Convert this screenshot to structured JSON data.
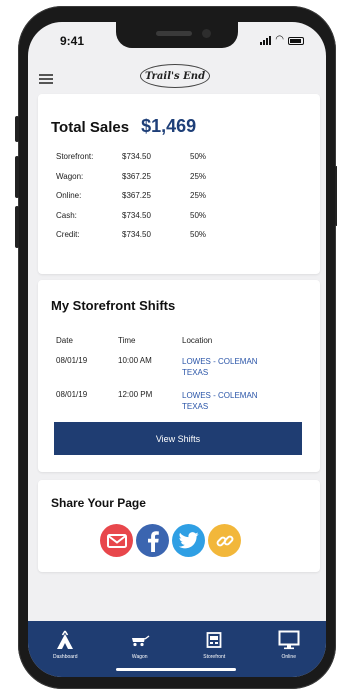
{
  "status": {
    "time": "9:41"
  },
  "header": {
    "logo_text": "Trail's End"
  },
  "sales": {
    "title": "Total Sales",
    "total": "$1,469",
    "rows": [
      {
        "label": "Storefront:",
        "amount": "$734.50",
        "percent": "50%"
      },
      {
        "label": "Wagon:",
        "amount": "$367.25",
        "percent": "25%"
      },
      {
        "label": "Online:",
        "amount": "$367.25",
        "percent": "25%"
      },
      {
        "label": "Cash:",
        "amount": "$734.50",
        "percent": "50%"
      },
      {
        "label": "Credit:",
        "amount": "$734.50",
        "percent": "50%"
      }
    ]
  },
  "shifts": {
    "title": "My Storefront Shifts",
    "columns": [
      "Date",
      "Time",
      "Location"
    ],
    "rows": [
      {
        "date": "08/01/19",
        "time": "10:00 AM",
        "location": "LOWES - COLEMAN TEXAS"
      },
      {
        "date": "08/01/19",
        "time": "12:00 PM",
        "location": "LOWES - COLEMAN TEXAS"
      }
    ],
    "button_label": "View Shifts"
  },
  "share": {
    "title": "Share Your Page",
    "icons": [
      "email-icon",
      "facebook-icon",
      "twitter-icon",
      "link-icon"
    ],
    "colors": {
      "email": "#e8474c",
      "facebook": "#3b65b0",
      "twitter": "#2f9fe4",
      "link": "#f2b73a"
    }
  },
  "tabs": [
    {
      "label": "Dashboard",
      "icon": "tent-icon"
    },
    {
      "label": "Wagon",
      "icon": "wagon-icon"
    },
    {
      "label": "Storefront",
      "icon": "storefront-icon"
    },
    {
      "label": "Online",
      "icon": "monitor-icon"
    }
  ],
  "colors": {
    "brand_navy": "#1f3d72",
    "total_blue": "#1e3f78",
    "link_blue": "#2a55a8",
    "background": "#f0f0f2"
  }
}
